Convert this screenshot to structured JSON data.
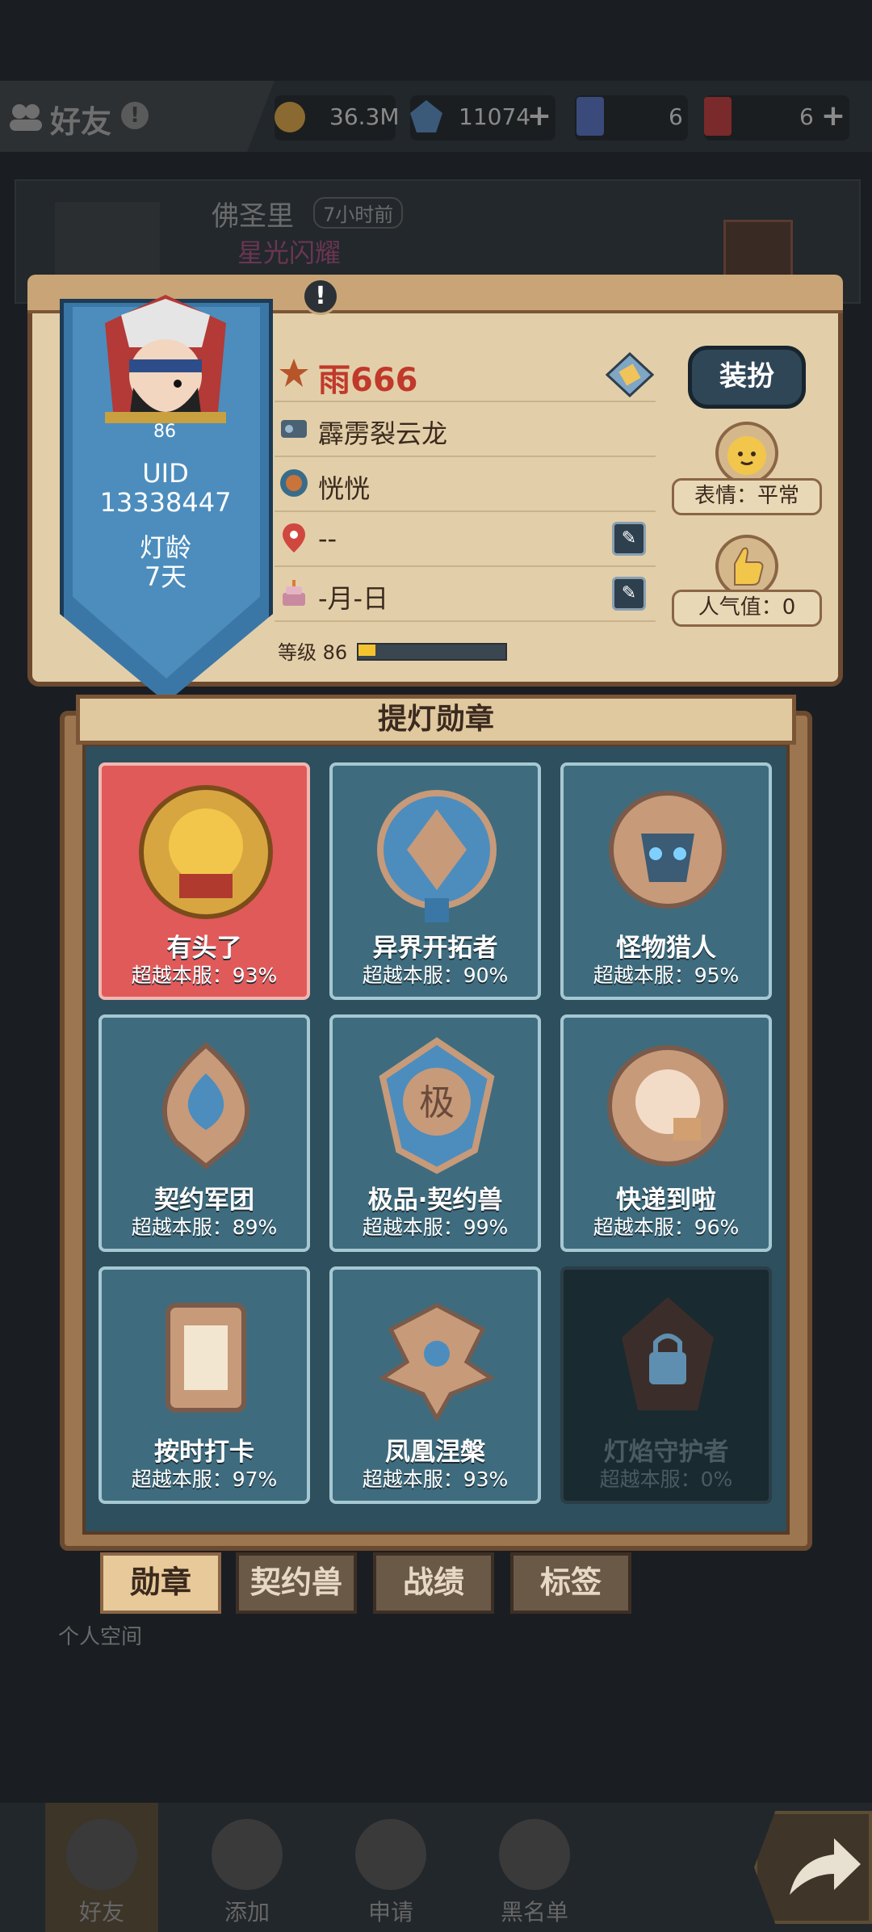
{
  "top": {
    "friends_title": "好友",
    "coins": "36.3M",
    "gems": "11074",
    "card_blue": "6",
    "card_red": "6",
    "plus": "+"
  },
  "background_card": {
    "name": "佛圣里",
    "time": "7小时前",
    "title": "星光闪耀"
  },
  "profile": {
    "alert": "!",
    "avatar_level": "86",
    "uid_label": "UID",
    "uid_value": "13338447",
    "age_label": "灯龄",
    "age_value": "7天",
    "name": "雨666",
    "pet": "霹雳裂云龙",
    "guild": "恍恍",
    "location": "--",
    "birthday": "-月-日",
    "level_text": "等级 86",
    "level_progress": 0.12,
    "dress_button": "装扮",
    "emote_label": "表情：平常",
    "popularity_label": "人气值：0"
  },
  "medals": {
    "title": "提灯勋章",
    "items": [
      {
        "name": "有头了",
        "rank": "超越本服：93%",
        "highlight": true,
        "locked": false
      },
      {
        "name": "异界开拓者",
        "rank": "超越本服：90%",
        "highlight": false,
        "locked": false
      },
      {
        "name": "怪物猎人",
        "rank": "超越本服：95%",
        "highlight": false,
        "locked": false
      },
      {
        "name": "契约军团",
        "rank": "超越本服：89%",
        "highlight": false,
        "locked": false
      },
      {
        "name": "极品·契约兽",
        "rank": "超越本服：99%",
        "highlight": false,
        "locked": false
      },
      {
        "name": "快递到啦",
        "rank": "超越本服：96%",
        "highlight": false,
        "locked": false
      },
      {
        "name": "按时打卡",
        "rank": "超越本服：97%",
        "highlight": false,
        "locked": false
      },
      {
        "name": "凤凰涅槃",
        "rank": "超越本服：93%",
        "highlight": false,
        "locked": false
      },
      {
        "name": "灯焰守护者",
        "rank": "超越本服：0%",
        "highlight": false,
        "locked": true
      }
    ]
  },
  "tabs": {
    "medals": "勋章",
    "pets": "契约兽",
    "records": "战绩",
    "tags": "标签"
  },
  "personal_space": "个人空间",
  "nav": {
    "friends": "好友",
    "add": "添加",
    "requests": "申请",
    "blacklist": "黑名单"
  },
  "colors": {
    "panel": "#e2cfa9",
    "banner": "#3b77a6",
    "medal_bg": "#3e6c7e",
    "medal_highlight": "#e05a5a",
    "name_red": "#c0392b"
  }
}
